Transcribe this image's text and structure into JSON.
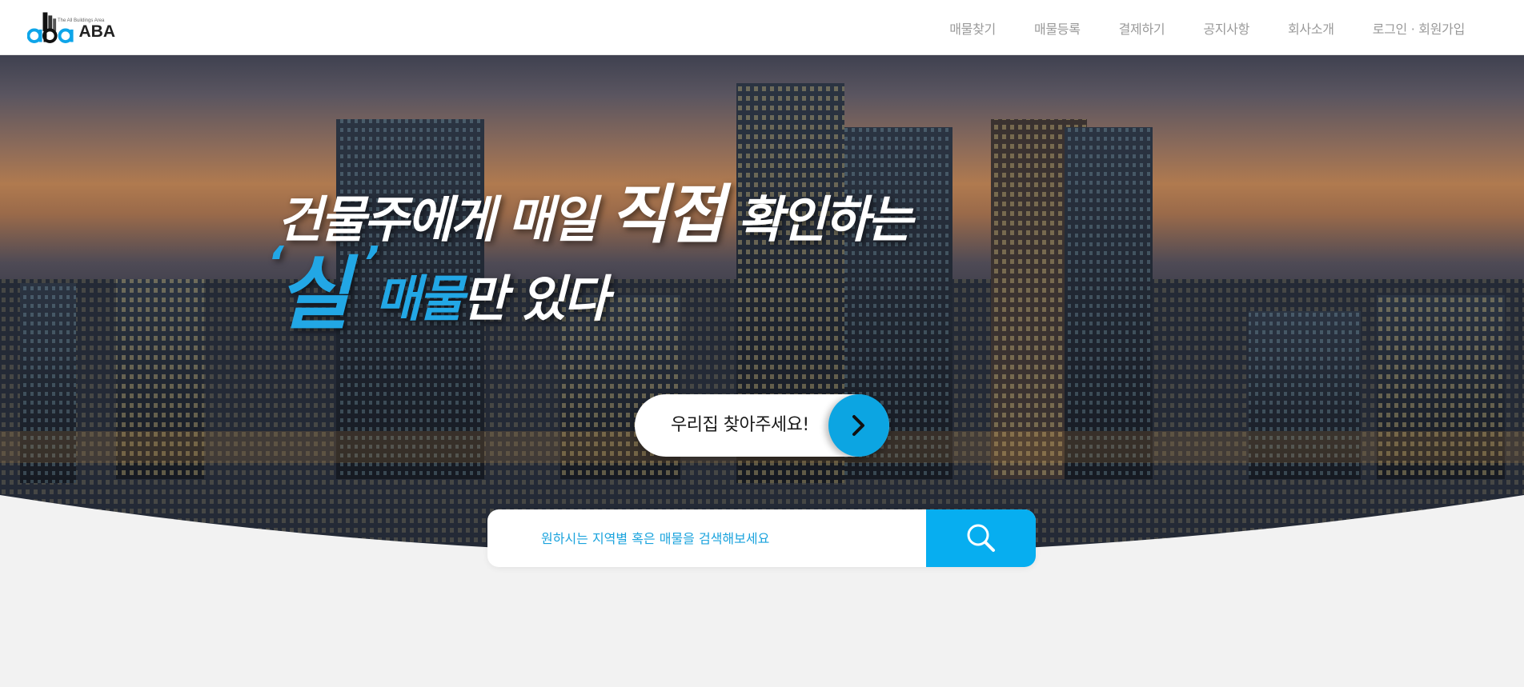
{
  "header": {
    "logo_text": "ABA",
    "logo_tagline": "The All Buildings Area",
    "nav": [
      {
        "label": "매물찾기"
      },
      {
        "label": "매물등록"
      },
      {
        "label": "결제하기"
      },
      {
        "label": "공지사항"
      },
      {
        "label": "회사소개"
      },
      {
        "label": "로그인 · 회원가입"
      }
    ]
  },
  "hero": {
    "line1_a": "건물주에게 매일 ",
    "line1_big": "직접",
    "line1_b": " 확인하는",
    "line2_quote_open": "‘",
    "line2_sil": "실",
    "line2_quote_close": "’",
    "line2_maemul": "매물",
    "line2_rest": "만 있다",
    "cta_label": "우리집 찾아주세요!",
    "cta_icon": "chevron-right-icon"
  },
  "search": {
    "placeholder": "원하시는 지역별 혹은 매물을 검색해보세요",
    "value": "",
    "button_icon": "search-icon"
  },
  "colors": {
    "accent": "#07aef0",
    "headline_accent": "#22a7e5",
    "nav_text": "#9a9a9a",
    "page_bg": "#f2f2f2"
  }
}
